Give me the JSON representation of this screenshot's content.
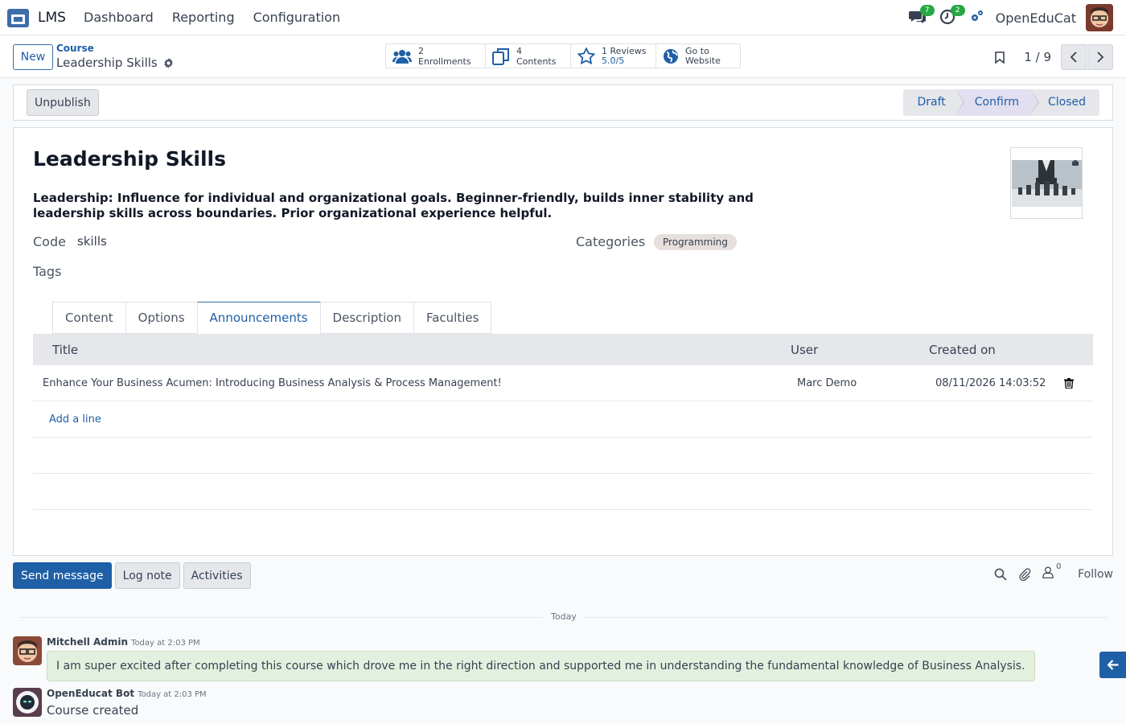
{
  "navbar": {
    "brand": "LMS",
    "menu": [
      "Dashboard",
      "Reporting",
      "Configuration"
    ],
    "messages_badge": "7",
    "activities_badge": "2",
    "company": "OpenEduCat"
  },
  "control_panel": {
    "new_label": "New",
    "breadcrumb_parent": "Course",
    "breadcrumb_current": "Leadership Skills",
    "smart_buttons": {
      "enrollments": "2 Enrollments",
      "contents": "4 Contents",
      "reviews_label": "1 Reviews",
      "reviews_value": "5.0/5",
      "website_line1": "Go to",
      "website_line2": "Website"
    },
    "pager": "1 / 9"
  },
  "statusbar": {
    "unpublish_label": "Unpublish",
    "stages": [
      "Draft",
      "Confirm",
      "Closed"
    ],
    "active_stage": "Confirm"
  },
  "form": {
    "title": "Leadership Skills",
    "description": "Leadership: Influence for individual and organizational goals. Beginner-friendly, builds inner stability and leadership skills across boundaries. Prior organizational experience helpful.",
    "code_label": "Code",
    "code_value": "skills",
    "categories_label": "Categories",
    "category_tag": "Programming",
    "tags_label": "Tags",
    "tabs": [
      "Content",
      "Options",
      "Announcements",
      "Description",
      "Faculties"
    ],
    "active_tab": "Announcements",
    "grid": {
      "headers": [
        "Title",
        "User",
        "Created on"
      ],
      "rows": [
        {
          "title": "Enhance Your Business Acumen: Introducing Business Analysis & Process Management!",
          "user": "Marc Demo",
          "created_on": "08/11/2026 14:03:52"
        }
      ],
      "add_line": "Add a line"
    }
  },
  "chatter": {
    "send_message": "Send message",
    "log_note": "Log note",
    "activities": "Activities",
    "followers_count": "0",
    "follow": "Follow",
    "date_separator": "Today",
    "messages": [
      {
        "author": "Mitchell Admin",
        "date": "Today at 2:03 PM",
        "body": "I am super excited after completing this course which drove me in the right direction and supported me in understanding the fundamental knowledge of Business Analysis."
      },
      {
        "author": "OpenEducat Bot",
        "date": "Today at 2:03 PM",
        "body": "Course created"
      }
    ]
  },
  "colors": {
    "primary": "#1f5fa6",
    "badge_green": "#28a745",
    "message_bubble": "#e4f0df"
  }
}
